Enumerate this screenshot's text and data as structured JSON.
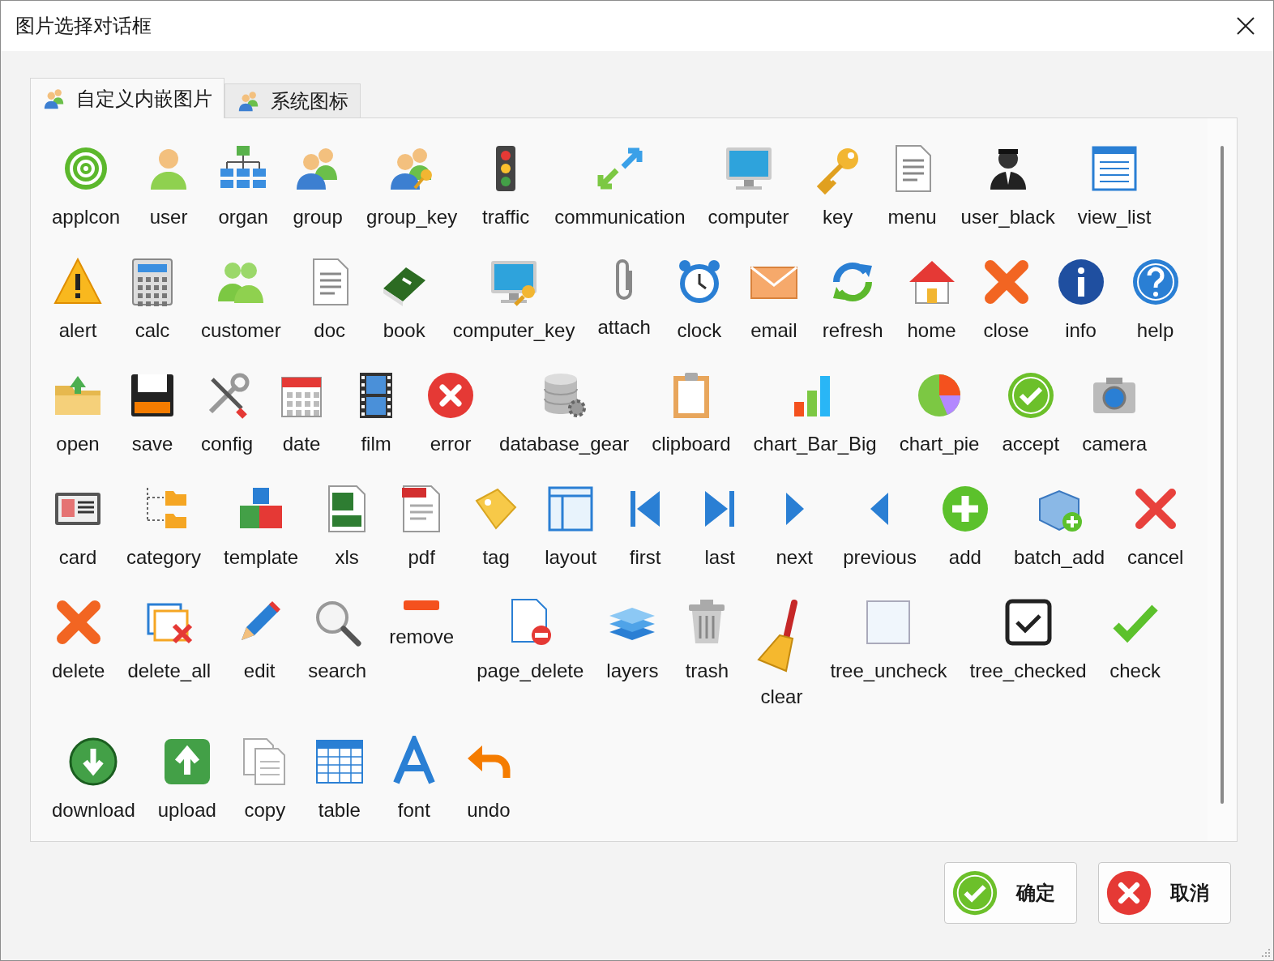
{
  "window": {
    "title": "图片选择对话框"
  },
  "tabs": [
    {
      "label": "自定义内嵌图片",
      "selected": true
    },
    {
      "label": "系统图标",
      "selected": false
    }
  ],
  "icon_rows": [
    [
      {
        "label": "applcon"
      },
      {
        "label": "user"
      },
      {
        "label": "organ"
      },
      {
        "label": "group"
      },
      {
        "label": "group_key"
      },
      {
        "label": "traffic"
      },
      {
        "label": "communication"
      },
      {
        "label": "computer"
      },
      {
        "label": "key"
      },
      {
        "label": "menu"
      },
      {
        "label": "user_black"
      },
      {
        "label": "view_list"
      }
    ],
    [
      {
        "label": "alert"
      },
      {
        "label": "calc"
      },
      {
        "label": "customer"
      },
      {
        "label": "doc"
      },
      {
        "label": "book"
      },
      {
        "label": "computer_key"
      },
      {
        "label": "attach"
      },
      {
        "label": "clock"
      },
      {
        "label": "email"
      },
      {
        "label": "refresh"
      },
      {
        "label": "home"
      },
      {
        "label": "close"
      },
      {
        "label": "info"
      },
      {
        "label": "help"
      }
    ],
    [
      {
        "label": "open"
      },
      {
        "label": "save"
      },
      {
        "label": "config"
      },
      {
        "label": "date"
      },
      {
        "label": "film"
      },
      {
        "label": "error"
      },
      {
        "label": "database_gear"
      },
      {
        "label": "clipboard"
      },
      {
        "label": "chart_Bar_Big"
      },
      {
        "label": "chart_pie"
      },
      {
        "label": "accept"
      },
      {
        "label": "camera"
      }
    ],
    [
      {
        "label": "card"
      },
      {
        "label": "category"
      },
      {
        "label": "template"
      },
      {
        "label": "xls"
      },
      {
        "label": "pdf"
      },
      {
        "label": "tag"
      },
      {
        "label": "layout"
      },
      {
        "label": "first"
      },
      {
        "label": "last"
      },
      {
        "label": "next"
      },
      {
        "label": "previous"
      },
      {
        "label": "add"
      },
      {
        "label": "batch_add"
      },
      {
        "label": "cancel"
      }
    ],
    [
      {
        "label": "delete"
      },
      {
        "label": "delete_all"
      },
      {
        "label": "edit"
      },
      {
        "label": "search"
      },
      {
        "label": "remove"
      },
      {
        "label": "page_delete"
      },
      {
        "label": "layers"
      },
      {
        "label": "trash"
      },
      {
        "label": "clear"
      },
      {
        "label": "tree_uncheck"
      },
      {
        "label": "tree_checked"
      },
      {
        "label": "check"
      }
    ],
    [
      {
        "label": "download"
      },
      {
        "label": "upload"
      },
      {
        "label": "copy"
      },
      {
        "label": "table"
      },
      {
        "label": "font"
      },
      {
        "label": "undo"
      }
    ]
  ],
  "buttons": [
    {
      "label": "确定",
      "kind": "confirm"
    },
    {
      "label": "取消",
      "kind": "cancel"
    }
  ]
}
